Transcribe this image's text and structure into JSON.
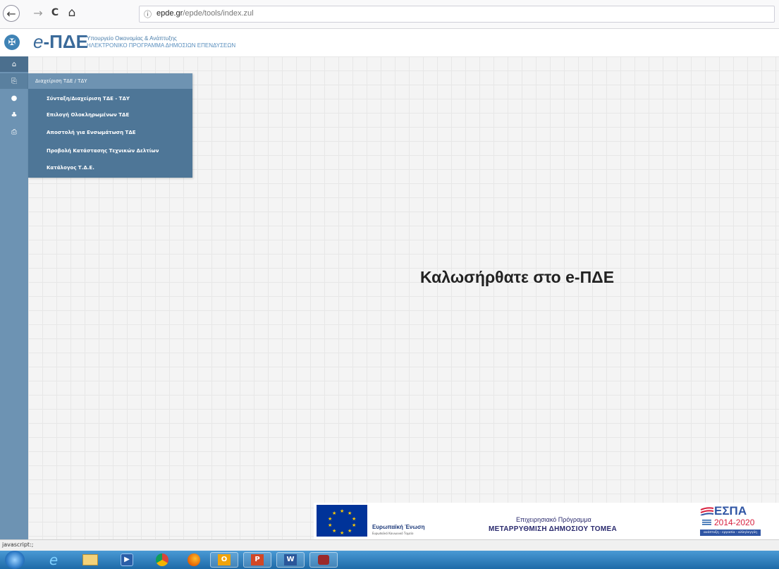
{
  "browser": {
    "back_icon": "←",
    "forward_icon": "→",
    "reload_icon": "C",
    "home_icon": "⌂",
    "info_icon": "ⓘ",
    "url_host": "epde.gr",
    "url_path": "/epde/tools/index.zul"
  },
  "header": {
    "logo_prefix": "e",
    "logo_main": "-ΠΔΕ",
    "ministry": "Υπουργείο Οικονομίας & Ανάπτυξης",
    "program": "ΗΛΕΚΤΡΟΝΙΚΟ ΠΡΟΓΡΑΜΜΑ ΔΗΜΟΣΙΩΝ ΕΠΕΝΔΥΣΕΩΝ"
  },
  "sidebar": {
    "icons": [
      {
        "name": "home-icon",
        "glyph": "⌂"
      },
      {
        "name": "documents-icon",
        "glyph": "⎘"
      },
      {
        "name": "comment-icon",
        "glyph": "●"
      },
      {
        "name": "sitemap-icon",
        "glyph": "♣"
      },
      {
        "name": "print-icon",
        "glyph": "⎙"
      }
    ]
  },
  "submenu": {
    "header": "Διαχείριση ΤΔΕ / ΤΔΥ",
    "items": [
      "Σύνταξη/Διαχείριση ΤΔΕ - ΤΔΥ",
      "Επιλογή Ολοκληρωμένων ΤΔΕ",
      "Αποστολή για Ενσωμάτωση ΤΔΕ",
      "Προβολή Κατάστασης Τεχνικών Δελτίων",
      "Κατάλογος Τ.Δ.Ε."
    ]
  },
  "main": {
    "welcome": "Καλωσήρθατε στο e-ΠΔΕ"
  },
  "footer": {
    "eu_label": "Ευρωπαϊκή Ένωση",
    "eu_sub": "Ευρωπαϊκό Κοινωνικό Ταμείο",
    "op_line1": "Επιχειρησιακό Πρόγραμμα",
    "op_line2": "ΜΕΤΑΡΡΥΘΜΙΣΗ ΔΗΜΟΣΙΟΥ ΤΟΜΕΑ",
    "espa_title": "ΕΣΠΑ",
    "espa_years": "2014-2020",
    "espa_slogan": "ανάπτυξη - εργασία - αλληλεγγύη"
  },
  "status_bar": {
    "text": "javascript:;"
  },
  "taskbar": {
    "items": [
      "ie-icon",
      "explorer-icon",
      "media-player-icon",
      "chrome-icon",
      "firefox-icon",
      "outlook-icon",
      "powerpoint-icon",
      "word-icon",
      "app-icon"
    ]
  }
}
